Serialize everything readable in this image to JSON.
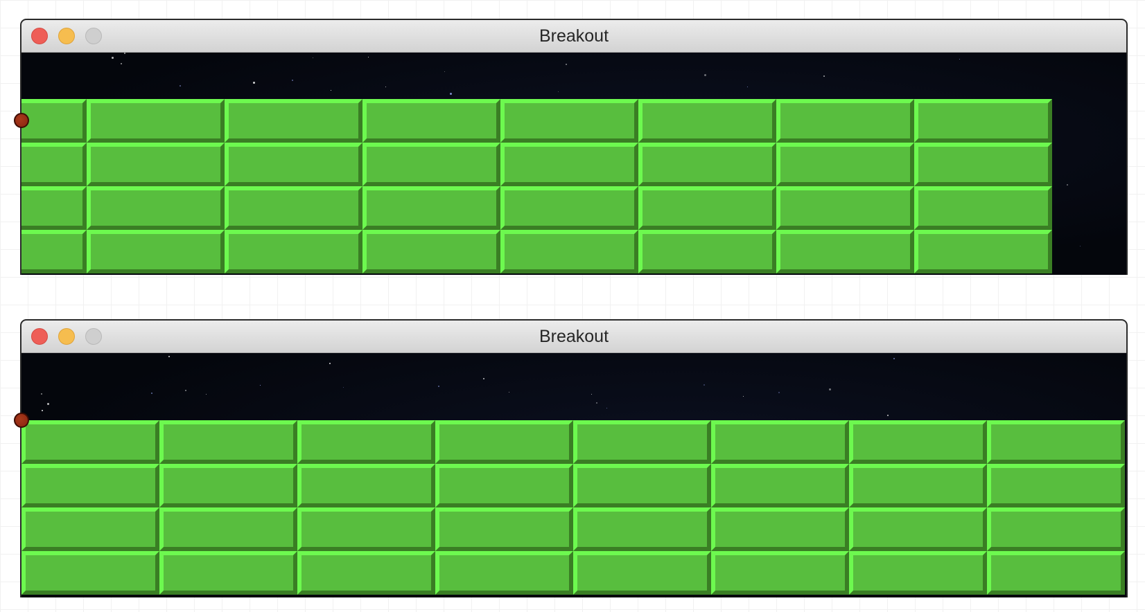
{
  "windows": [
    {
      "title": "Breakout",
      "brick_rows": 4,
      "bricks_per_row": 8,
      "brick_color": "#58be3e"
    },
    {
      "title": "Breakout",
      "brick_rows": 4,
      "bricks_per_row": 8,
      "brick_color": "#58be3e"
    }
  ],
  "ball_color": "#8a2410"
}
